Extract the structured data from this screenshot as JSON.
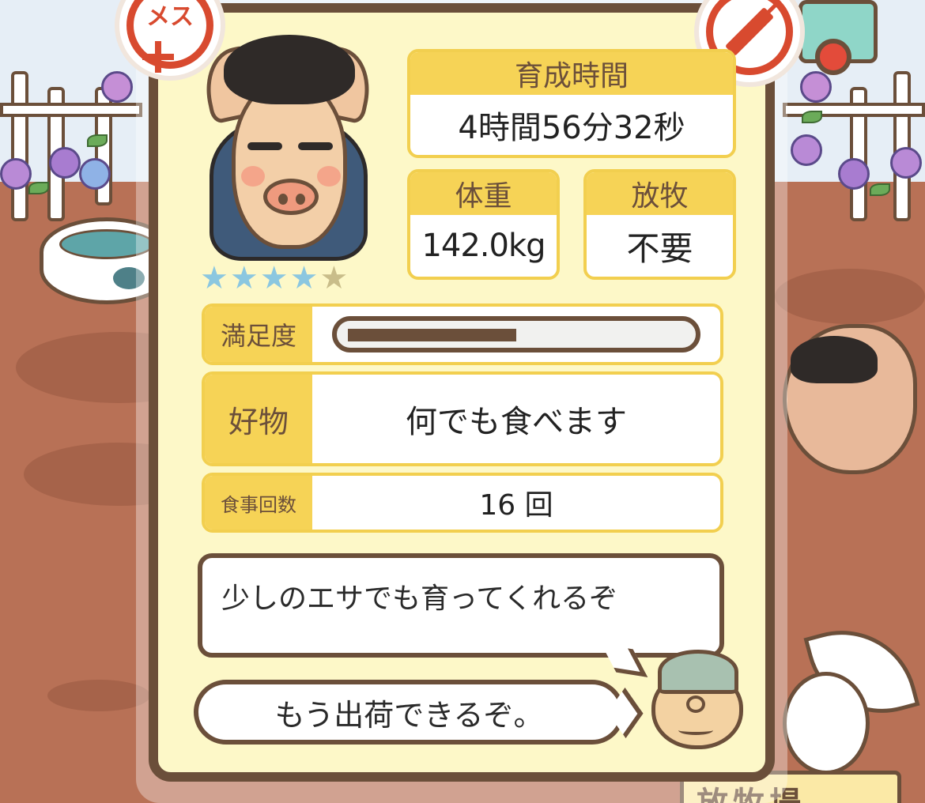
{
  "badges": {
    "gender_label": "メス",
    "gender_icon": "female-icon",
    "vaccine_icon": "syringe-icon"
  },
  "pig": {
    "rating": 4,
    "rating_max": 5,
    "stars": [
      "★",
      "★",
      "★",
      "★",
      "★"
    ]
  },
  "stats": {
    "time": {
      "label": "育成時間",
      "value": "4時間56分32秒"
    },
    "weight": {
      "label": "体重",
      "value": "142.0kg"
    },
    "grazing": {
      "label": "放牧",
      "value": "不要"
    }
  },
  "satisfaction": {
    "label": "満足度",
    "level": 0.5
  },
  "favorite": {
    "label": "好物",
    "value": "何でも食べます"
  },
  "meals": {
    "label": "食事回数",
    "value": "16 回"
  },
  "bubbles": {
    "info": "少しのエサでも育ってくれるぞ",
    "ship": "もう出荷できるぞ。"
  },
  "background": {
    "sign_text": "放牧場"
  },
  "colors": {
    "frame": "#6b4f3a",
    "panel": "#fdf8c8",
    "header": "#f6d356",
    "badge_red": "#d84a2f",
    "star_filled": "#8bc7e0",
    "star_empty": "#c9bd8a"
  }
}
